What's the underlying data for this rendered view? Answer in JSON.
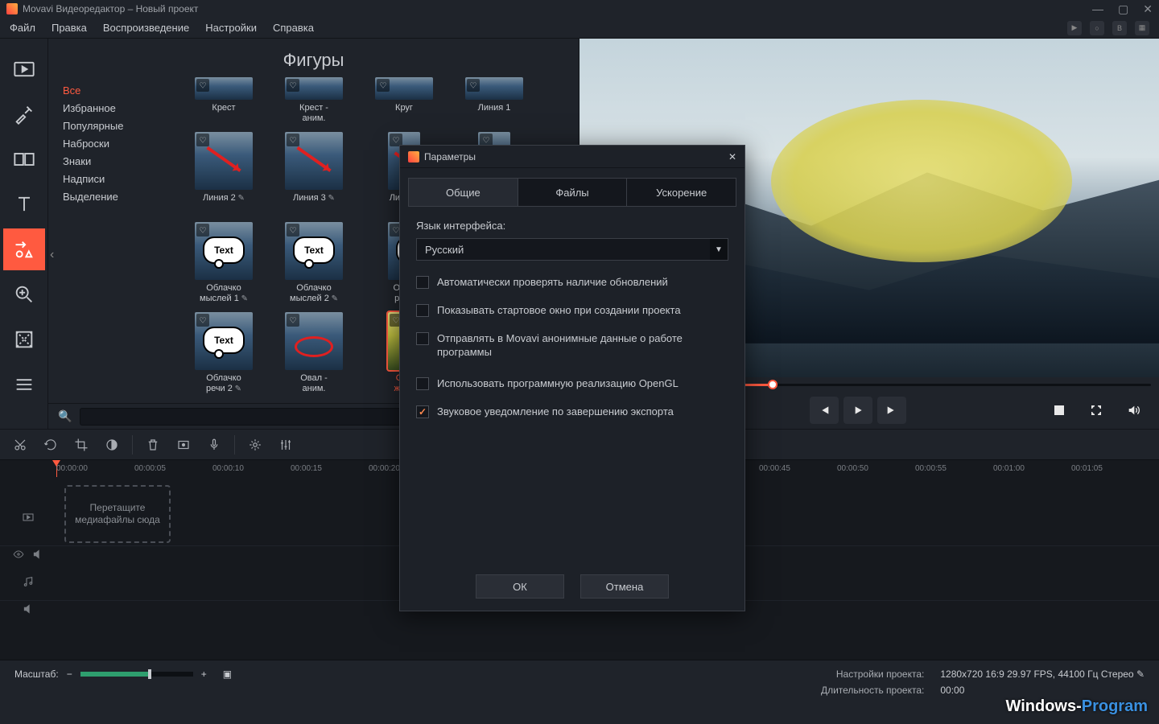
{
  "window": {
    "title": "Movavi Видеоредактор – Новый проект"
  },
  "menubar": {
    "items": [
      "Файл",
      "Правка",
      "Воспроизведение",
      "Настройки",
      "Справка"
    ]
  },
  "toolrail": {
    "active_index": 4
  },
  "browser": {
    "title": "Фигуры",
    "categories": [
      "Все",
      "Избранное",
      "Популярные",
      "Наброски",
      "Знаки",
      "Надписи",
      "Выделение"
    ],
    "active_category": 0,
    "search_placeholder": "",
    "items": [
      {
        "label": "Крест",
        "variant": "half"
      },
      {
        "label": "Крест -\nаним.",
        "variant": "half"
      },
      {
        "label": "Круг",
        "variant": "half"
      },
      {
        "label": "Линия 1",
        "variant": "half"
      },
      {
        "label": "Линия 2",
        "variant": "arrow",
        "editable": true
      },
      {
        "label": "Линия 3",
        "variant": "arrow",
        "editable": true
      },
      {
        "label": "Лини…",
        "variant": "arrow",
        "cut": true
      },
      {
        "label": "",
        "variant": "plain",
        "cut": true
      },
      {
        "label": "Облачко\nмыслей 1",
        "variant": "bubble",
        "editable": true
      },
      {
        "label": "Облачко\nмыслей 2",
        "variant": "bubble",
        "editable": true
      },
      {
        "label": "Обла\nречи",
        "variant": "bubble",
        "cut": true
      },
      {
        "label": "",
        "variant": "plain",
        "cut": true
      },
      {
        "label": "Облачко\nречи 2",
        "variant": "bubble",
        "editable": true
      },
      {
        "label": "Овал -\nаним.",
        "variant": "oval"
      },
      {
        "label": "Ова\nжёлт",
        "variant": "selected",
        "selected": true,
        "cut": true
      },
      {
        "label": "",
        "variant": "plain",
        "cut": true
      }
    ]
  },
  "preview": {
    "scrub_percent": 32
  },
  "ruler": {
    "ticks": [
      "00:00:00",
      "00:00:05",
      "00:00:10",
      "00:00:15",
      "00:00:20",
      "",
      "",
      "",
      "",
      "00:00:45",
      "00:00:50",
      "00:00:55",
      "00:01:00",
      "00:01:05"
    ]
  },
  "timeline": {
    "drop_hint": "Перетащите\nмедиафайлы\nсюда"
  },
  "bottombar": {
    "zoom_label": "Масштаб:",
    "zoom_minus": "−",
    "zoom_plus": "+",
    "proj_settings_label": "Настройки проекта:",
    "proj_settings_value": "1280x720 16:9 29.97 FPS, 44100 Гц Стерео",
    "duration_label": "Длительность проекта:",
    "duration_value": "00:00",
    "watermark_1": "Windows-",
    "watermark_2": "Program"
  },
  "modal": {
    "title": "Параметры",
    "tabs": [
      "Общие",
      "Файлы",
      "Ускорение"
    ],
    "active_tab": 0,
    "lang_label": "Язык интерфейса:",
    "lang_value": "Русский",
    "opts": [
      {
        "label": "Автоматически проверять наличие обновлений",
        "checked": false
      },
      {
        "label": "Показывать стартовое окно при создании проекта",
        "checked": false
      },
      {
        "label": "Отправлять в Movavi анонимные данные о работе программы",
        "checked": false
      },
      {
        "label": "Использовать программную реализацию OpenGL",
        "checked": false
      },
      {
        "label": "Звуковое уведомление по завершению экспорта",
        "checked": true
      }
    ],
    "ok": "ОК",
    "cancel": "Отмена"
  }
}
